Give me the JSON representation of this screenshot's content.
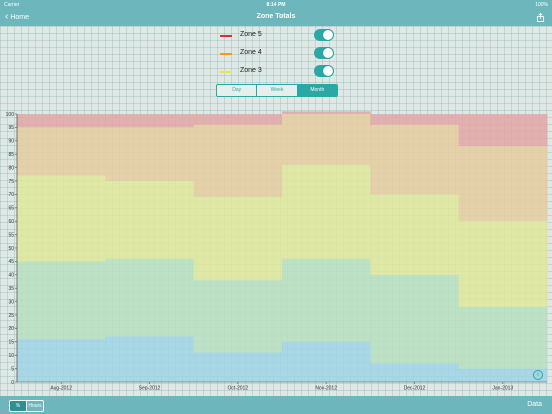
{
  "status": {
    "carrier": "Carrier",
    "time": "8:14 PM",
    "battery": "100%"
  },
  "nav": {
    "back_label": "Home",
    "title": "Zone Totals",
    "share_icon": "share-icon"
  },
  "zones": [
    {
      "label": "Zone 5",
      "color": "#e02d2d",
      "enabled": true
    },
    {
      "label": "Zone 4",
      "color": "#f39a22",
      "enabled": true
    },
    {
      "label": "Zone 3",
      "color": "#e8e84a",
      "enabled": true
    }
  ],
  "range_segment": {
    "options": [
      "Day",
      "Week",
      "Month"
    ],
    "selected": "Month"
  },
  "unit_segment": {
    "options": [
      "%",
      "Hours"
    ],
    "selected": "%"
  },
  "toolbar": {
    "data_label": "Data"
  },
  "info_icon": "info-icon",
  "chart_data": {
    "type": "area",
    "stacked": true,
    "categories": [
      "Aug-2012",
      "Sep-2012",
      "Oct-2012",
      "Nov-2012",
      "Dec-2012",
      "Jan-2013"
    ],
    "ylim": [
      0,
      100
    ],
    "yticks": [
      0,
      5,
      10,
      15,
      20,
      25,
      30,
      35,
      40,
      45,
      50,
      55,
      60,
      65,
      70,
      75,
      80,
      85,
      90,
      95,
      100
    ],
    "grid": true,
    "series": [
      {
        "color": "#9fd4e6",
        "values": [
          16,
          17,
          11,
          15,
          7,
          5
        ]
      },
      {
        "color": "#b7dfbf",
        "values": [
          29,
          29,
          27,
          31,
          33,
          23
        ]
      },
      {
        "color": "#dfe79a",
        "values": [
          32,
          29,
          31,
          35,
          30,
          32
        ]
      },
      {
        "color": "#e5cc9f",
        "values": [
          18,
          20,
          27,
          19,
          26,
          28
        ]
      },
      {
        "color": "#e2a6a6",
        "values": [
          5,
          5,
          4,
          1,
          4,
          12
        ]
      }
    ]
  }
}
